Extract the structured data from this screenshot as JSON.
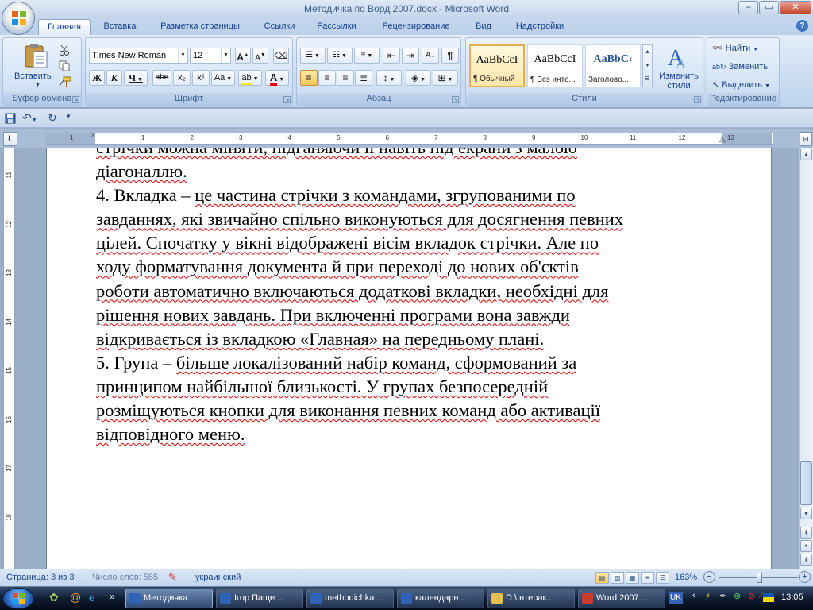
{
  "window": {
    "title": "Методичка по Ворд 2007.docx - Microsoft Word",
    "min": "‒",
    "max": "▭",
    "close": "✕"
  },
  "tabs": [
    "Главная",
    "Вставка",
    "Разметка страницы",
    "Ссылки",
    "Рассылки",
    "Рецензирование",
    "Вид",
    "Надстройки"
  ],
  "ribbon": {
    "clipboard": {
      "label": "Буфер обмена",
      "paste": "Вставить"
    },
    "font": {
      "label": "Шрифт",
      "family": "Times New Roman",
      "size": "12",
      "bold": "Ж",
      "italic": "К",
      "underline": "Ч",
      "strike": "abe",
      "sub": "x₂",
      "sup": "x²",
      "case": "Aa",
      "grow": "A",
      "shrink": "A"
    },
    "paragraph": {
      "label": "Абзац"
    },
    "styles": {
      "label": "Стили",
      "cards": [
        {
          "preview": "AaBbCcI",
          "name": "¶ Обычный"
        },
        {
          "preview": "AaBbCcI",
          "name": "¶ Без инте..."
        },
        {
          "preview": "AaBbC‹",
          "name": "Заголово..."
        }
      ],
      "change": "Изменить стили"
    },
    "editing": {
      "label": "Редактирование",
      "find": "Найти",
      "replace": "Заменить",
      "select": "Выделить"
    }
  },
  "ruler": {
    "h_numbers": [
      "1",
      "1",
      "2",
      "3",
      "4",
      "5",
      "6",
      "7",
      "8",
      "9",
      "10",
      "11",
      "12",
      "13"
    ],
    "v_numbers": [
      "11",
      "12",
      "13",
      "14",
      "15",
      "16",
      "17",
      "18"
    ]
  },
  "document": {
    "lines": [
      [
        {
          "t": "стрічки можна міняти, підганяючи її навіть під екрани з малою",
          "s": true
        }
      ],
      [
        {
          "t": "діагоналлю.",
          "s": true
        }
      ],
      [
        {
          "t": "4. Вкладка – ",
          "s": false
        },
        {
          "t": "це частина стрічки з командами, згрупованими по",
          "s": true
        }
      ],
      [
        {
          "t": "завданнях, які звичайно спільно виконуються для досягнення певних",
          "s": true
        }
      ],
      [
        {
          "t": "цілей. Спочатку у вікні відображені вісім вкладок стрічки. Але по",
          "s": true
        }
      ],
      [
        {
          "t": "ходу форматування документа й при переході до нових об'єктів",
          "s": true
        }
      ],
      [
        {
          "t": "роботи автоматично включаються додаткові вкладки, необхідні для",
          "s": true
        }
      ],
      [
        {
          "t": "рішення нових завдань. При включенні програми вона завжди",
          "s": true
        }
      ],
      [
        {
          "t": "відкривається із вкладкою «Главная» на передньому плані.",
          "s": true
        }
      ],
      [
        {
          "t": "5. Група – ",
          "s": false
        },
        {
          "t": "більше локалізований набір команд, сформований за",
          "s": true
        }
      ],
      [
        {
          "t": "принципом найбільшої близькості. У групах безпосередній",
          "s": true
        }
      ],
      [
        {
          "t": "розміщуються кнопки для виконання певних команд або активації",
          "s": true
        }
      ],
      [
        {
          "t": "відповідного меню.",
          "s": true
        }
      ]
    ]
  },
  "status": {
    "page": "Страница: 3 из 3",
    "words": "Число слов: 585",
    "lang": "украинский",
    "zoom": "163%",
    "minus": "−",
    "plus": "+"
  },
  "taskbar": {
    "items": [
      "Методичка...",
      "Ігор Паще...",
      "methodichka ...",
      "календарн...",
      "D:\\Інтерак...",
      "Word 2007...."
    ],
    "lang": "UK",
    "clock": "13:05"
  },
  "colors": {
    "accent": "#15428b",
    "ribbon": "#c8dbf0",
    "spell": "#e00000"
  }
}
